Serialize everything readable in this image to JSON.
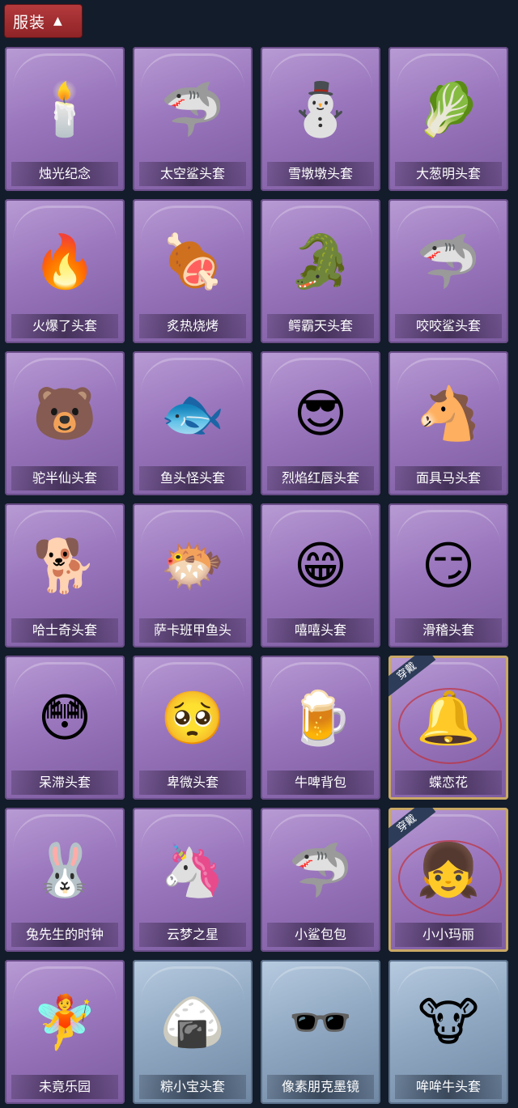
{
  "header": {
    "label": "服装",
    "chevron": "chevron-up-icon"
  },
  "colors": {
    "background": "#131c2a",
    "tab": "#a42c30",
    "card_purple": "#9a76bd",
    "card_blue": "#91a9c3",
    "worn_border": "#c9a865"
  },
  "items": [
    {
      "label": "烛光纪念",
      "icon": "🕯️",
      "style": "purple",
      "worn": ""
    },
    {
      "label": "太空鲨头套",
      "icon": "🦈",
      "style": "purple",
      "worn": ""
    },
    {
      "label": "雪墩墩头套",
      "icon": "⛄",
      "style": "purple",
      "worn": ""
    },
    {
      "label": "大葱明头套",
      "icon": "🥬",
      "style": "purple",
      "worn": ""
    },
    {
      "label": "火爆了头套",
      "icon": "🔥",
      "style": "purple",
      "worn": ""
    },
    {
      "label": "炙热烧烤",
      "icon": "🍖",
      "style": "purple",
      "worn": ""
    },
    {
      "label": "鳄霸天头套",
      "icon": "🐊",
      "style": "purple",
      "worn": ""
    },
    {
      "label": "咬咬鲨头套",
      "icon": "🦈",
      "style": "purple",
      "worn": ""
    },
    {
      "label": "驼半仙头套",
      "icon": "🐻",
      "style": "purple",
      "worn": ""
    },
    {
      "label": "鱼头怪头套",
      "icon": "🐟",
      "style": "purple",
      "worn": ""
    },
    {
      "label": "烈焰红唇头套",
      "icon": "😎",
      "style": "purple",
      "worn": ""
    },
    {
      "label": "面具马头套",
      "icon": "🐴",
      "style": "purple",
      "worn": ""
    },
    {
      "label": "哈士奇头套",
      "icon": "🐕",
      "style": "purple",
      "worn": ""
    },
    {
      "label": "萨卡班甲鱼头",
      "icon": "🐡",
      "style": "purple",
      "worn": ""
    },
    {
      "label": "嘻嘻头套",
      "icon": "😁",
      "style": "purple",
      "worn": ""
    },
    {
      "label": "滑稽头套",
      "icon": "😏",
      "style": "purple",
      "worn": ""
    },
    {
      "label": "呆滞头套",
      "icon": "😳",
      "style": "purple",
      "worn": ""
    },
    {
      "label": "卑微头套",
      "icon": "🥺",
      "style": "purple",
      "worn": ""
    },
    {
      "label": "牛啤背包",
      "icon": "🍺",
      "style": "purple",
      "worn": ""
    },
    {
      "label": "蝶恋花",
      "icon": "🔔",
      "style": "purple",
      "worn": "穿戴"
    },
    {
      "label": "兔先生的时钟",
      "icon": "🐰",
      "style": "purple",
      "worn": ""
    },
    {
      "label": "云梦之星",
      "icon": "🦄",
      "style": "purple",
      "worn": ""
    },
    {
      "label": "小鲨包包",
      "icon": "🦈",
      "style": "purple",
      "worn": ""
    },
    {
      "label": "小小玛丽",
      "icon": "👧",
      "style": "purple",
      "worn": "穿戴"
    },
    {
      "label": "未竟乐园",
      "icon": "🧚",
      "style": "purple",
      "worn": ""
    },
    {
      "label": "粽小宝头套",
      "icon": "🍙",
      "style": "blue",
      "worn": ""
    },
    {
      "label": "像素朋克墨镜",
      "icon": "🕶️",
      "style": "blue",
      "worn": ""
    },
    {
      "label": "哞哞牛头套",
      "icon": "🐮",
      "style": "blue",
      "worn": ""
    }
  ]
}
